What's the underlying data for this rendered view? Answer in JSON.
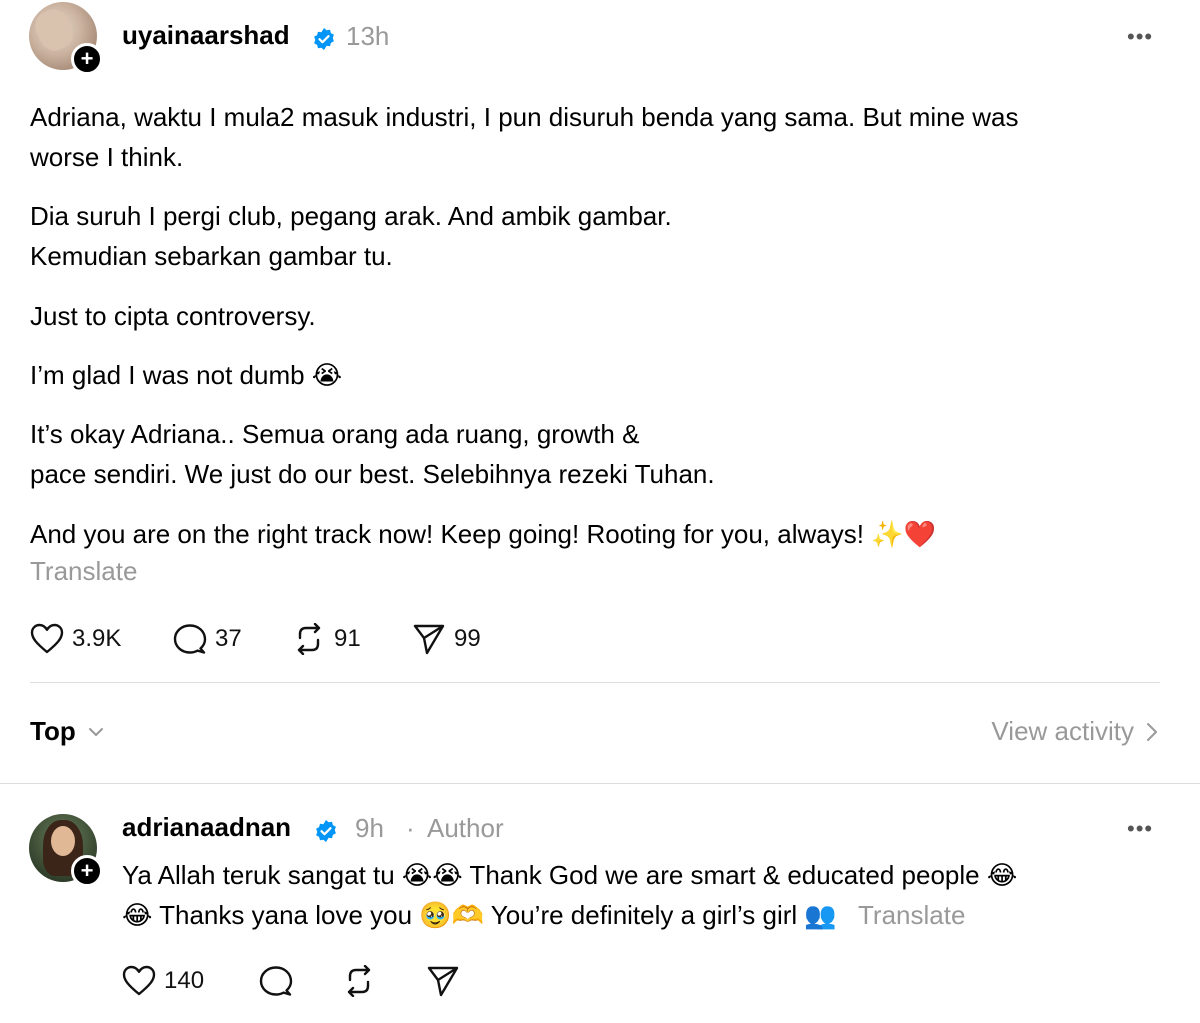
{
  "post": {
    "username": "uyainaarshad",
    "time": "13h",
    "more": "•••",
    "paragraphs": [
      [
        "Adriana, waktu I mula2 masuk industri, I pun disuruh benda yang sama. But mine was",
        "worse I think."
      ],
      [
        "Dia suruh I pergi club, pegang arak. And ambik gambar.",
        "Kemudian sebarkan gambar tu."
      ],
      [
        "Just to cipta controversy."
      ],
      [
        "I’m glad I was not dumb 😭"
      ],
      [
        "It’s okay Adriana.. Semua orang ada ruang, growth &",
        "pace sendiri. We just do our best. Selebihnya rezeki Tuhan."
      ],
      [
        "And you are on the right track now! Keep going! Rooting for you, always! ✨❤️"
      ]
    ],
    "translate": "Translate",
    "likes": "3.9K",
    "comments": "37",
    "reposts": "91",
    "shares": "99"
  },
  "sort": {
    "label": "Top",
    "view_activity": "View activity"
  },
  "reply": {
    "username": "adrianaadnan",
    "time": "9h",
    "separator": "·",
    "author_badge": "Author",
    "more": "•••",
    "line1": "Ya Allah teruk sangat tu 😭😭 Thank God we are smart & educated people 😂",
    "line2": "😂 Thanks yana love you 🥹🫶 You’re definitely a girl’s girl 👥",
    "translate": "Translate",
    "likes": "140"
  },
  "colors": {
    "verified": "#0095f6",
    "muted": "#999999",
    "heart_red": "#d2232a"
  }
}
